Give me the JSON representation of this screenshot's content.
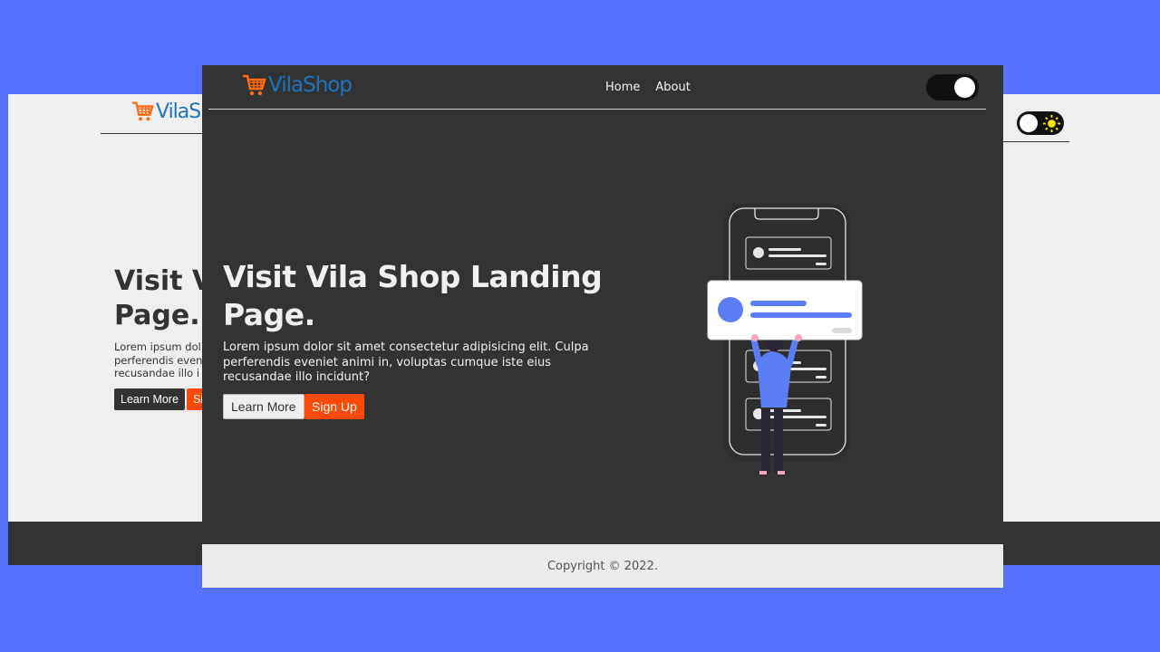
{
  "brand": {
    "name": "VilaShop",
    "logo_color": "#1e73be",
    "cart_color": "#ff6a13"
  },
  "background_color": "#5572ff",
  "light_preview": {
    "logo_text": "VilaShop",
    "title_lines": [
      "Visit V",
      "Page."
    ],
    "text_lines": [
      "Lorem ipsum dol",
      "perferendis even",
      "recusandae illo i"
    ],
    "learn_more_label": "Learn More",
    "sign_up_label": "Si",
    "toggle_icon": "sun-icon"
  },
  "nav": {
    "links": [
      "Home",
      "About"
    ],
    "toggle_icon": "moon-icon"
  },
  "hero": {
    "title": "Visit Vila Shop Landing Page.",
    "text": "Lorem ipsum dolor sit amet consectetur adipisicing elit. Culpa perferendis eveniet animi in, voluptas cumque iste eius recusandae illo incidunt?",
    "learn_more_label": "Learn More",
    "sign_up_label": "Sign Up",
    "accent_color": "#ff4a06",
    "illustration": "person-holding-phone-card-illustration"
  },
  "footer": {
    "copyright": "Copyright © 2022."
  }
}
